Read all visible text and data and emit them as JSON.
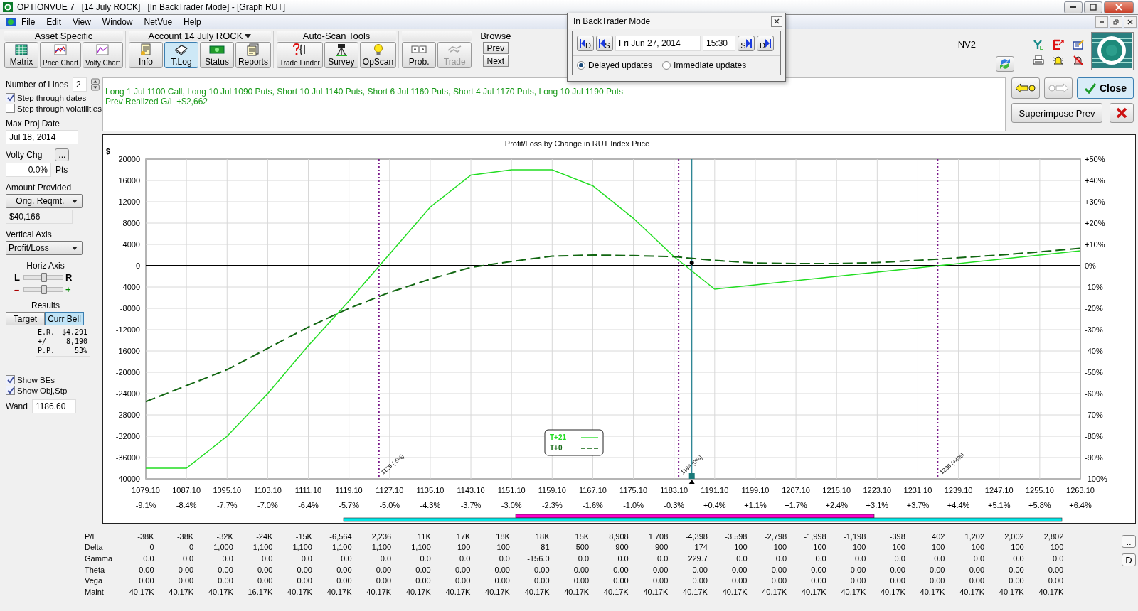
{
  "window": {
    "title": "OPTIONVUE 7   [14 July ROCK]   [In BackTrader Mode] - [Graph RUT]"
  },
  "menu": [
    "File",
    "Edit",
    "View",
    "Window",
    "NetVue",
    "Help"
  ],
  "toolbar": {
    "groups": [
      {
        "title": "Asset Specific",
        "dropdown": false,
        "buttons": [
          {
            "label": "Matrix",
            "selected": false,
            "disabled": false
          },
          {
            "label": "Price Chart",
            "selected": false,
            "disabled": false
          },
          {
            "label": "Volty Chart",
            "selected": false,
            "disabled": false
          }
        ]
      },
      {
        "title": "Account 14 July ROCK",
        "dropdown": true,
        "buttons": [
          {
            "label": "Info",
            "selected": false,
            "disabled": false
          },
          {
            "label": "T.Log",
            "selected": true,
            "disabled": false
          },
          {
            "label": "Status",
            "selected": false,
            "disabled": false
          },
          {
            "label": "Reports",
            "selected": false,
            "disabled": false
          }
        ]
      },
      {
        "title": "Auto-Scan Tools",
        "dropdown": false,
        "buttons": [
          {
            "label": "Trade Finder",
            "selected": false,
            "disabled": false
          },
          {
            "label": "Survey",
            "selected": false,
            "disabled": false
          },
          {
            "label": "OpScan",
            "selected": false,
            "disabled": false
          }
        ]
      },
      {
        "buttons": [
          {
            "label": "Prob.",
            "selected": false,
            "disabled": false
          },
          {
            "label": "Trade",
            "selected": false,
            "disabled": true
          }
        ]
      }
    ],
    "browse": {
      "title": "Browse",
      "buttons": [
        "Prev",
        "Next"
      ]
    },
    "account_label": "NV2"
  },
  "dialog": {
    "title": "In BackTrader Mode",
    "back_buttons": [
      "D",
      "S"
    ],
    "date": "Fri Jun 27, 2014",
    "time": "15:30",
    "forward_buttons": [
      "S",
      "D"
    ],
    "update_modes": [
      {
        "label": "Delayed updates",
        "selected": true
      },
      {
        "label": "Immediate updates",
        "selected": false
      }
    ]
  },
  "settings": {
    "number_of_lines": {
      "label": "Number of Lines",
      "value": "2"
    },
    "step_options": [
      {
        "label": "Step through dates",
        "checked": true
      },
      {
        "label": "Step through volatilities",
        "checked": false
      }
    ],
    "max_proj_date": {
      "label": "Max Proj Date",
      "value": "Jul 18, 2014"
    },
    "volty_chg": {
      "label": "Volty Chg",
      "value": "0.0%",
      "unit": "Pts",
      "button": "..."
    },
    "amount_provided": {
      "label": "Amount Provided",
      "selection": "= Orig. Reqmt.",
      "value": "$40,166"
    },
    "vertical_axis": {
      "label": "Vertical Axis",
      "selection": "Profit/Loss"
    },
    "horiz_axis": {
      "label": "Horiz Axis",
      "sliders": [
        {
          "left": "L",
          "right": "R",
          "level": 0.5
        },
        {
          "left": "–",
          "right": "+",
          "level": 0.5
        }
      ]
    },
    "results": {
      "label": "Results",
      "tabs": [
        {
          "label": "Target",
          "selected": false
        },
        {
          "label": "Curr Bell",
          "selected": true
        }
      ],
      "stats": [
        {
          "name": "E.R.",
          "value": "$4,291"
        },
        {
          "name": "+/-",
          "value": "8,190"
        },
        {
          "name": "P.P.",
          "value": "53%"
        }
      ]
    },
    "show_options": [
      {
        "label": "Show BEs",
        "checked": true
      },
      {
        "label": "Show Obj,Stp",
        "checked": true
      }
    ],
    "wand": {
      "label": "Wand",
      "value": "1186.60"
    }
  },
  "position": {
    "lines": [
      "Long 1 Jul 1100 Call, Long 10 Jul 1090 Puts, Short 10 Jul 1140 Puts, Short 6 Jul 1160 Puts, Short 4 Jul 1170 Puts, Long 10 Jul 1190 Puts",
      "Prev Realized G/L +$2,662"
    ]
  },
  "actions": [
    {
      "kind": "back",
      "disabled": false
    },
    {
      "kind": "forward",
      "disabled": true
    },
    {
      "kind": "close",
      "label": "Close"
    },
    {
      "kind": "superimpose",
      "label": "Superimpose Prev"
    },
    {
      "kind": "cancel"
    }
  ],
  "graph": {
    "chart_data": {
      "type": "line",
      "title": "Profit/Loss by Change in RUT Index Price",
      "ylabel": "$",
      "x": [
        1079.1,
        1087.1,
        1095.1,
        1103.1,
        1111.1,
        1119.1,
        1127.1,
        1135.1,
        1143.1,
        1151.1,
        1159.1,
        1167.1,
        1175.1,
        1183.1,
        1191.1,
        1199.1,
        1207.1,
        1215.1,
        1223.1,
        1231.1,
        1239.1,
        1247.1,
        1255.1,
        1263.1
      ],
      "series": [
        {
          "name": "T+21",
          "color": "#22dd22",
          "line_style": "solid",
          "values": [
            -38000,
            -38000,
            -32000,
            -24000,
            -15000,
            -6600,
            2200,
            11000,
            17000,
            18000,
            18000,
            15000,
            8900,
            1700,
            -4400,
            -3600,
            -2800,
            -2000,
            -1200,
            -400,
            400,
            1200,
            2000,
            2800
          ]
        },
        {
          "name": "T+0",
          "color": "#116611",
          "line_style": "dashed",
          "values": [
            -25500,
            -22500,
            -19500,
            -15500,
            -11500,
            -8000,
            -5000,
            -2500,
            -300,
            800,
            1800,
            2000,
            1900,
            1700,
            1000,
            500,
            400,
            400,
            600,
            1000,
            1500,
            2000,
            2600,
            3300
          ]
        }
      ],
      "xlim": [
        1079.1,
        1263.1
      ],
      "ylim": [
        -40000,
        20000
      ],
      "xticks": [
        {
          "value": 1079.1,
          "label": "1079.10"
        },
        {
          "value": 1087.1,
          "label": "1087.10"
        },
        {
          "value": 1095.1,
          "label": "1095.10"
        },
        {
          "value": 1103.1,
          "label": "1103.10"
        },
        {
          "value": 1111.1,
          "label": "1111.10"
        },
        {
          "value": 1119.1,
          "label": "1119.10"
        },
        {
          "value": 1127.1,
          "label": "1127.10"
        },
        {
          "value": 1135.1,
          "label": "1135.10"
        },
        {
          "value": 1143.1,
          "label": "1143.10"
        },
        {
          "value": 1151.1,
          "label": "1151.10"
        },
        {
          "value": 1159.1,
          "label": "1159.10"
        },
        {
          "value": 1167.1,
          "label": "1167.10"
        },
        {
          "value": 1175.1,
          "label": "1175.10"
        },
        {
          "value": 1183.1,
          "label": "1183.10"
        },
        {
          "value": 1191.1,
          "label": "1191.10"
        },
        {
          "value": 1199.1,
          "label": "1199.10"
        },
        {
          "value": 1207.1,
          "label": "1207.10"
        },
        {
          "value": 1215.1,
          "label": "1215.10"
        },
        {
          "value": 1223.1,
          "label": "1223.10"
        },
        {
          "value": 1231.1,
          "label": "1231.10"
        },
        {
          "value": 1239.1,
          "label": "1239.10"
        },
        {
          "value": 1247.1,
          "label": "1247.10"
        },
        {
          "value": 1255.1,
          "label": "1255.10"
        },
        {
          "value": 1263.1,
          "label": "1263.10"
        }
      ],
      "yticks": [
        20000,
        16000,
        12000,
        8000,
        4000,
        0,
        -4000,
        -8000,
        -12000,
        -16000,
        -20000,
        -24000,
        -28000,
        -32000,
        -36000,
        -40000
      ],
      "grid": true,
      "ref_lines": [
        {
          "axis": "x",
          "value": 1125,
          "label": "1125 (-5%)",
          "color": "#7a1a8a"
        },
        {
          "axis": "x",
          "value": 1184,
          "label": "1184 (0%)",
          "color": "#7a1a8a"
        },
        {
          "axis": "x",
          "value": 1235,
          "label": "1235 (+4%)",
          "color": "#7a1a8a"
        },
        {
          "axis": "x",
          "value": 1186.6,
          "color": "#1a7a8a"
        }
      ]
    },
    "x_percent_labels": [
      "-9.1%",
      "-8.4%",
      "-7.7%",
      "-7.0%",
      "-6.4%",
      "-5.7%",
      "-5.0%",
      "-4.3%",
      "-3.7%",
      "-3.0%",
      "-2.3%",
      "-1.6%",
      "-1.0%",
      "-0.3%",
      "+0.4%",
      "+1.1%",
      "+1.7%",
      "+2.4%",
      "+3.1%",
      "+3.7%",
      "+4.4%",
      "+5.1%",
      "+5.8%",
      "+6.4%"
    ],
    "right_axis_labels": [
      "+50%",
      "+40%",
      "+30%",
      "+20%",
      "+10%",
      "0%",
      "-10%",
      "-20%",
      "-30%",
      "-40%",
      "-50%",
      "-60%",
      "-70%",
      "-80%",
      "-90%",
      "-100%"
    ]
  },
  "greeks_table": {
    "rows": [
      {
        "label": "P/L",
        "values": [
          "-38K",
          "-38K",
          "-32K",
          "-24K",
          "-15K",
          "-6,564",
          "2,236",
          "11K",
          "17K",
          "18K",
          "18K",
          "15K",
          "8,908",
          "1,708",
          "-4,398",
          "-3,598",
          "-2,798",
          "-1,998",
          "-1,198",
          "-398",
          "402",
          "1,202",
          "2,002",
          "2,802"
        ]
      },
      {
        "label": "Delta",
        "values": [
          "0",
          "0",
          "1,000",
          "1,100",
          "1,100",
          "1,100",
          "1,100",
          "1,100",
          "100",
          "100",
          "-81",
          "-500",
          "-900",
          "-900",
          "-174",
          "100",
          "100",
          "100",
          "100",
          "100",
          "100",
          "100",
          "100",
          "100"
        ]
      },
      {
        "label": "Gamma",
        "values": [
          "0.0",
          "0.0",
          "0.0",
          "0.0",
          "0.0",
          "0.0",
          "0.0",
          "0.0",
          "0.0",
          "0.0",
          "-156.0",
          "0.0",
          "0.0",
          "0.0",
          "229.7",
          "0.0",
          "0.0",
          "0.0",
          "0.0",
          "0.0",
          "0.0",
          "0.0",
          "0.0",
          "0.0"
        ]
      },
      {
        "label": "Theta",
        "values": [
          "0.00",
          "0.00",
          "0.00",
          "0.00",
          "0.00",
          "0.00",
          "0.00",
          "0.00",
          "0.00",
          "0.00",
          "0.00",
          "0.00",
          "0.00",
          "0.00",
          "0.00",
          "0.00",
          "0.00",
          "0.00",
          "0.00",
          "0.00",
          "0.00",
          "0.00",
          "0.00",
          "0.00"
        ]
      },
      {
        "label": "Vega",
        "values": [
          "0.00",
          "0.00",
          "0.00",
          "0.00",
          "0.00",
          "0.00",
          "0.00",
          "0.00",
          "0.00",
          "0.00",
          "0.00",
          "0.00",
          "0.00",
          "0.00",
          "0.00",
          "0.00",
          "0.00",
          "0.00",
          "0.00",
          "0.00",
          "0.00",
          "0.00",
          "0.00",
          "0.00"
        ]
      },
      {
        "label": "Maint",
        "values": [
          "40.17K",
          "40.17K",
          "40.17K",
          "16.17K",
          "40.17K",
          "40.17K",
          "40.17K",
          "40.17K",
          "40.17K",
          "40.17K",
          "40.17K",
          "40.17K",
          "40.17K",
          "40.17K",
          "40.17K",
          "40.17K",
          "40.17K",
          "40.17K",
          "40.17K",
          "40.17K",
          "40.17K",
          "40.17K",
          "40.17K",
          "40.17K"
        ]
      }
    ],
    "buttons": [
      "..",
      "D"
    ]
  }
}
